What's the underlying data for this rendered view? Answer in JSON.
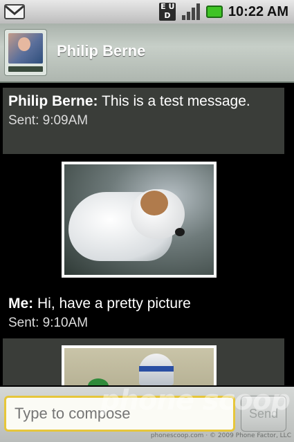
{
  "status_bar": {
    "network_badge": [
      "E",
      "U",
      "D"
    ],
    "time": "10:22 AM",
    "icons": [
      "gmail-icon",
      "network-type-icon",
      "signal-bars-icon",
      "battery-icon"
    ],
    "battery_color": "#3fc425"
  },
  "header": {
    "contact_name": "Philip Berne",
    "avatar_icon": "contact-photo"
  },
  "conversation": {
    "messages": [
      {
        "sender": "Philip Berne:",
        "text": " This is a test message.",
        "time": "Sent: 9:09AM",
        "attachment": "dog-photo"
      },
      {
        "sender": "Me:",
        "text": " Hi, have a pretty picture",
        "time": "Sent: 9:10AM",
        "attachment": "robot-toy-photo"
      }
    ],
    "incoming_bubble_color": "#3a3d39"
  },
  "compose": {
    "placeholder": "Type to compose",
    "send_label": "Send",
    "focus_color": "#e6c63a"
  },
  "watermark": {
    "logo_text": "phone scoop",
    "copyright": "phonescoop.com · © 2009 Phone Factor, LLC"
  }
}
